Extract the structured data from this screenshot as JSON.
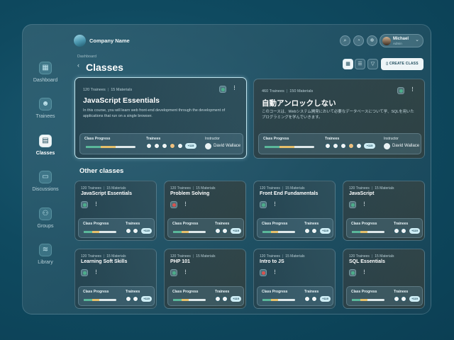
{
  "app": {
    "company": "Company Name"
  },
  "user": {
    "name": "Michael",
    "role": "Admin"
  },
  "sidebar": {
    "items": [
      {
        "label": "Dashboard",
        "icon": "dashboard-icon",
        "glyph": "▦"
      },
      {
        "label": "Trainees",
        "icon": "person-icon",
        "glyph": "☻"
      },
      {
        "label": "Classes",
        "icon": "book-icon",
        "glyph": "▤"
      },
      {
        "label": "Discussions",
        "icon": "chat-icon",
        "glyph": "▭"
      },
      {
        "label": "Groups",
        "icon": "group-icon",
        "glyph": "⚇"
      },
      {
        "label": "Library",
        "icon": "layers-icon",
        "glyph": "≋"
      }
    ]
  },
  "page": {
    "breadcrumb": "Dashboard",
    "title": "Classes",
    "back_glyph": "‹",
    "create_label": "CREATE CLASS",
    "other_heading": "Other classes"
  },
  "featured": [
    {
      "trainees": "120 Trainees",
      "materials": "15 Materials",
      "title": "JavaScript Essentials",
      "desc": "In this course, you will learn web front-end development through the development of applications that run on a single browser.",
      "progress_label": "Class Progress",
      "trainees_label": "Trainees",
      "instructor_label": "Instructor",
      "instructor": "David Wallace",
      "more": "+115",
      "status_color": "#4cae8a",
      "progress": 0.6
    },
    {
      "trainees": "460 Trainees",
      "materials": "150 Materials",
      "title": "自動アンロックしない",
      "desc": "このコースは、Webシステム開発において必要なデータベースについて学、SQLを用いたプログラミングを学んでいきます。",
      "progress_label": "Class Progress",
      "trainees_label": "Trainees",
      "instructor_label": "Instructor",
      "instructor": "David Wallace",
      "more": "+115",
      "status_color": "#4cae8a",
      "progress": 0.6
    }
  ],
  "classes": [
    {
      "trainees": "120 Trainees",
      "materials": "15 Materials",
      "title": "JavaScript Essentials",
      "status_color": "#4cae8a",
      "progress_label": "Class Progress",
      "trainees_label": "Trainees",
      "more": "+119",
      "progress": 0.6
    },
    {
      "trainees": "120 Trainees",
      "materials": "15 Materials",
      "title": "Problem Solving",
      "status_color": "#d9534f",
      "progress_label": "Class Progress",
      "trainees_label": "Trainees",
      "more": "+119",
      "progress": 0.6
    },
    {
      "trainees": "120 Trainees",
      "materials": "15 Materials",
      "title": "Front End Fundamentals",
      "status_color": "#4cae8a",
      "progress_label": "Class Progress",
      "trainees_label": "Trainees",
      "more": "+119",
      "progress": 0.6
    },
    {
      "trainees": "120 Trainees",
      "materials": "15 Materials",
      "title": "JavaScript",
      "status_color": "#4cae8a",
      "progress_label": "Class Progress",
      "trainees_label": "Trainees",
      "more": "+119",
      "progress": 0.6
    },
    {
      "trainees": "120 Trainees",
      "materials": "15 Materials",
      "title": "Learning Soft Skills",
      "status_color": "#4cae8a",
      "progress_label": "Class Progress",
      "trainees_label": "Trainees",
      "more": "+119",
      "progress": 0.6
    },
    {
      "trainees": "120 Trainees",
      "materials": "15 Materials",
      "title": "PHP 101",
      "status_color": "#4cae8a",
      "progress_label": "Class Progress",
      "trainees_label": "Trainees",
      "more": "+119",
      "progress": 0.6
    },
    {
      "trainees": "120 Trainees",
      "materials": "15 Materials",
      "title": "Intro to JS",
      "status_color": "#d9534f",
      "progress_label": "Class Progress",
      "trainees_label": "Trainees",
      "more": "+119",
      "progress": 0.6
    },
    {
      "trainees": "120 Trainees",
      "materials": "15 Materials",
      "title": "SQL Essentials",
      "status_color": "#4cae8a",
      "progress_label": "Class Progress",
      "trainees_label": "Trainees",
      "more": "+119",
      "progress": 0.6
    }
  ]
}
